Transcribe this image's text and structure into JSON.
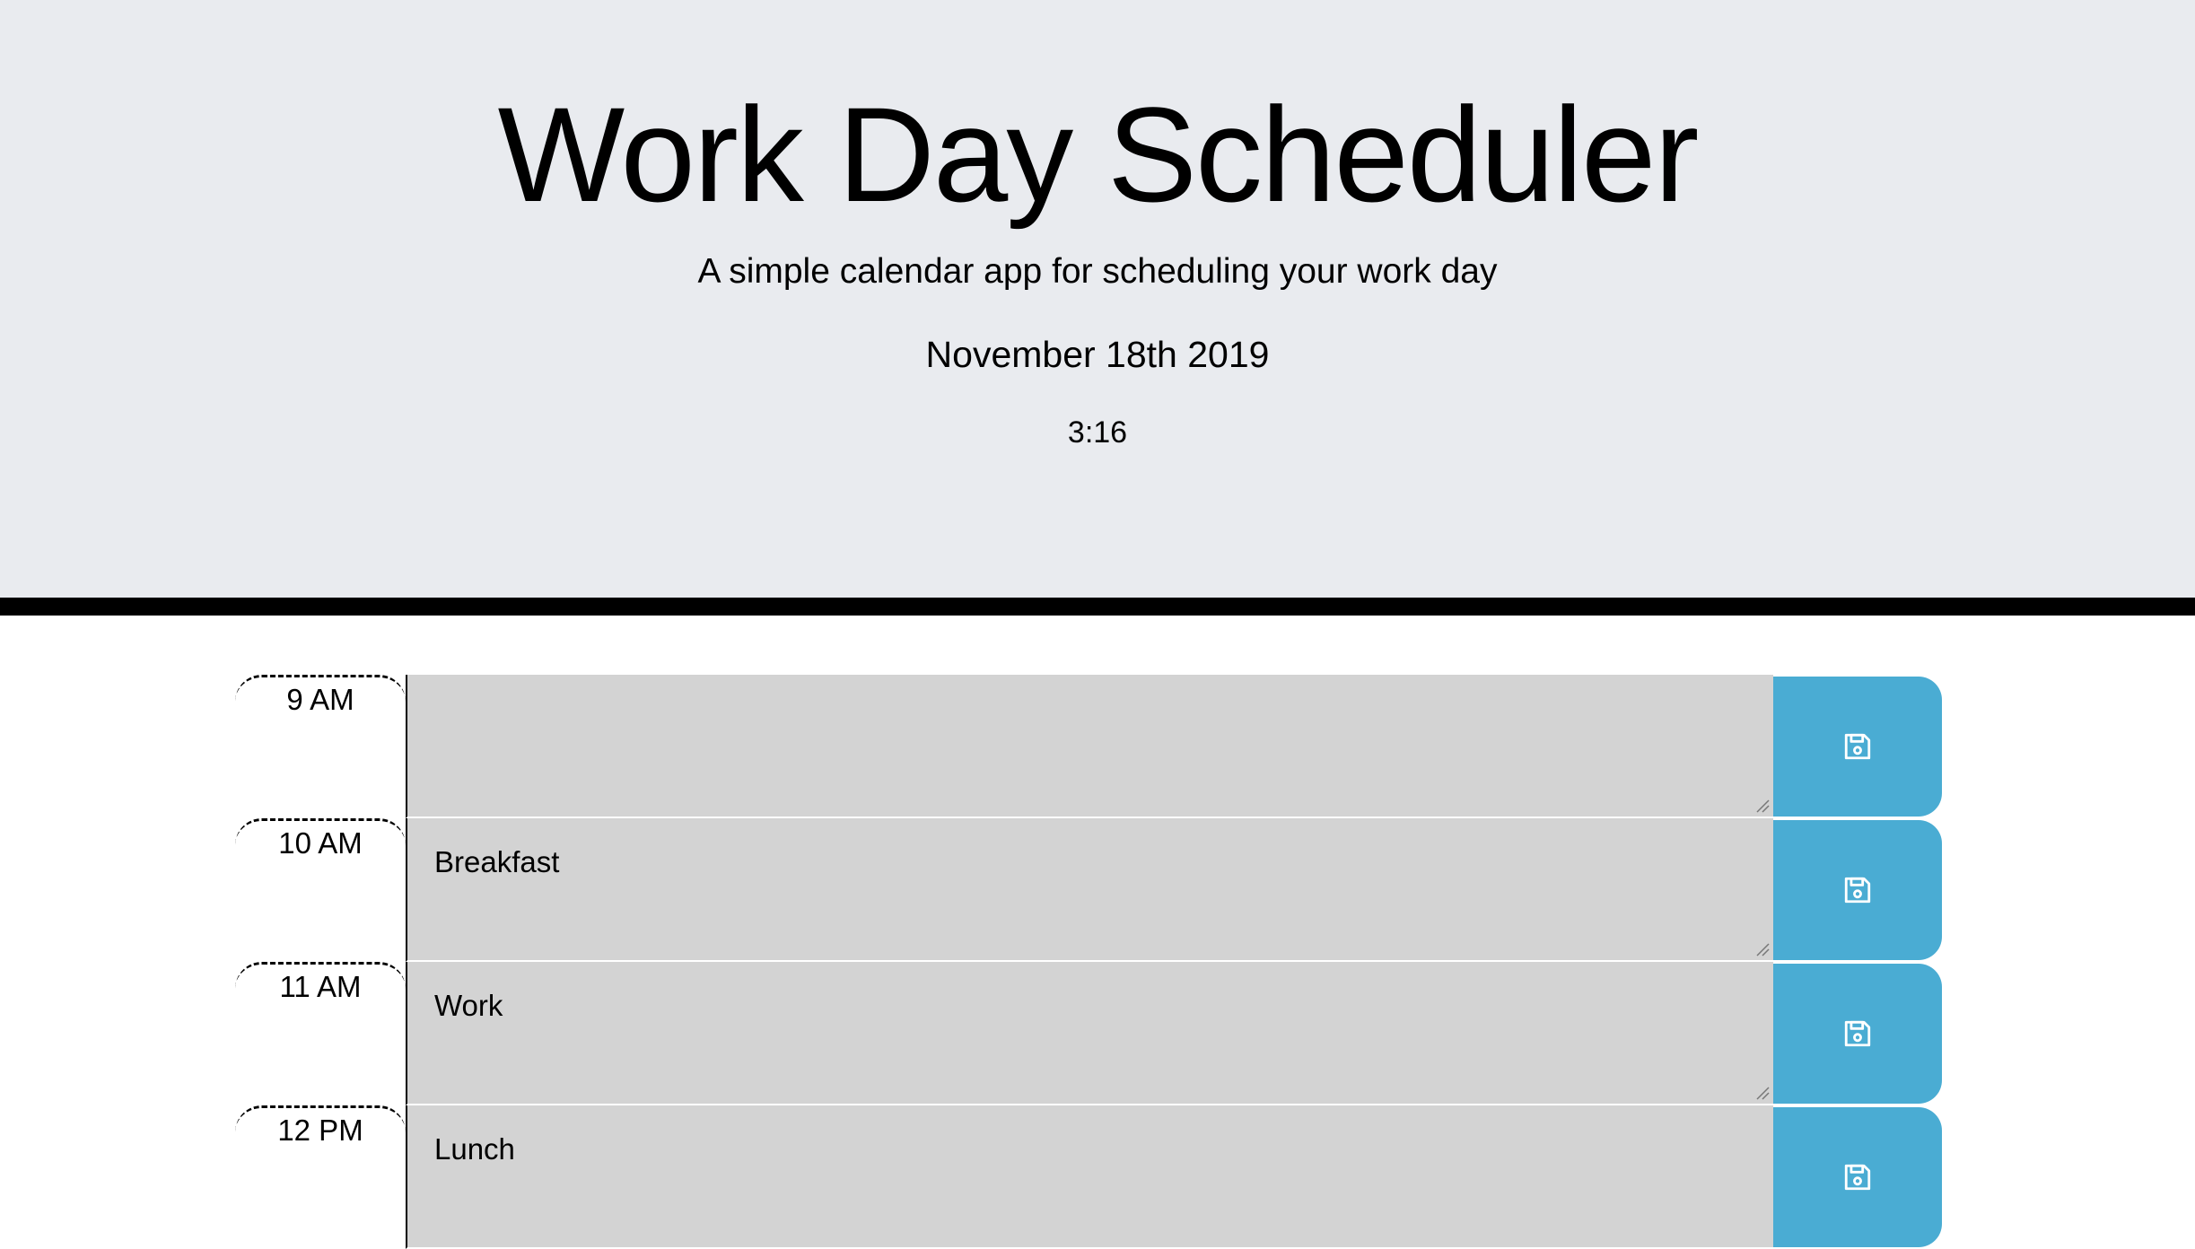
{
  "header": {
    "title": "Work Day Scheduler",
    "subtitle": "A simple calendar app for scheduling your work day",
    "date": "November 18th 2019",
    "time": "3:16"
  },
  "colors": {
    "header_bg": "#e9ebef",
    "past_row": "#d3d3d3",
    "save_button": "#4aacd3"
  },
  "schedule": [
    {
      "hour": "9 AM",
      "text": ""
    },
    {
      "hour": "10 AM",
      "text": "Breakfast"
    },
    {
      "hour": "11 AM",
      "text": "Work"
    },
    {
      "hour": "12 PM",
      "text": "Lunch"
    }
  ],
  "icons": {
    "save": "floppy-disk-icon"
  }
}
